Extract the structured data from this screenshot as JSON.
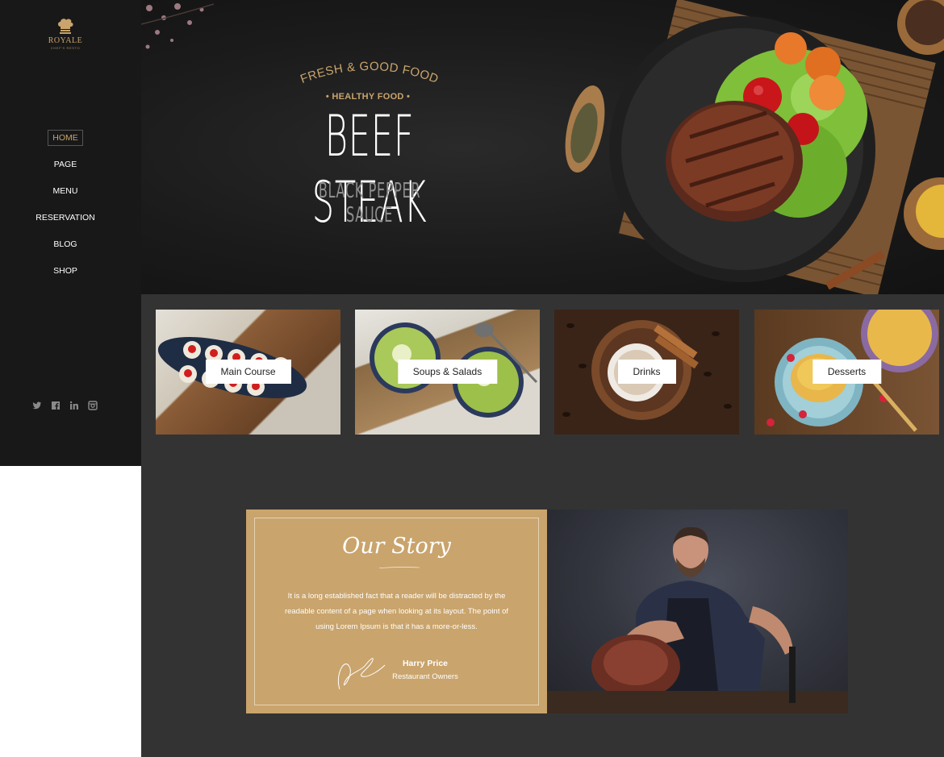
{
  "brand": {
    "name": "ROYALE",
    "tagline": "CHEF'S RESTO",
    "accent": "#c9a46c"
  },
  "nav": {
    "items": [
      {
        "label": "HOME",
        "active": true
      },
      {
        "label": "PAGE",
        "active": false
      },
      {
        "label": "MENU",
        "active": false
      },
      {
        "label": "RESERVATION",
        "active": false
      },
      {
        "label": "BLOG",
        "active": false
      },
      {
        "label": "SHOP",
        "active": false
      }
    ]
  },
  "social": [
    "twitter-icon",
    "facebook-icon",
    "linkedin-icon",
    "instagram-icon"
  ],
  "hero": {
    "arc_text": "FRESH & GOOD FOOD",
    "tag": "• HEALTHY FOOD •",
    "title": "BEEF STEAK",
    "subtitle": "BLACK PEPPER SAUCE"
  },
  "categories": [
    {
      "label": "Main Course"
    },
    {
      "label": "Soups & Salads"
    },
    {
      "label": "Drinks"
    },
    {
      "label": "Desserts"
    }
  ],
  "story": {
    "title": "Our Story",
    "text": "It is a long established fact that a reader will be distracted by the readable content of a page when looking at its layout. The point of using Lorem Ipsum is that it has a more-or-less.",
    "author_name": "Harry Price",
    "author_role": "Restaurant Owners"
  }
}
